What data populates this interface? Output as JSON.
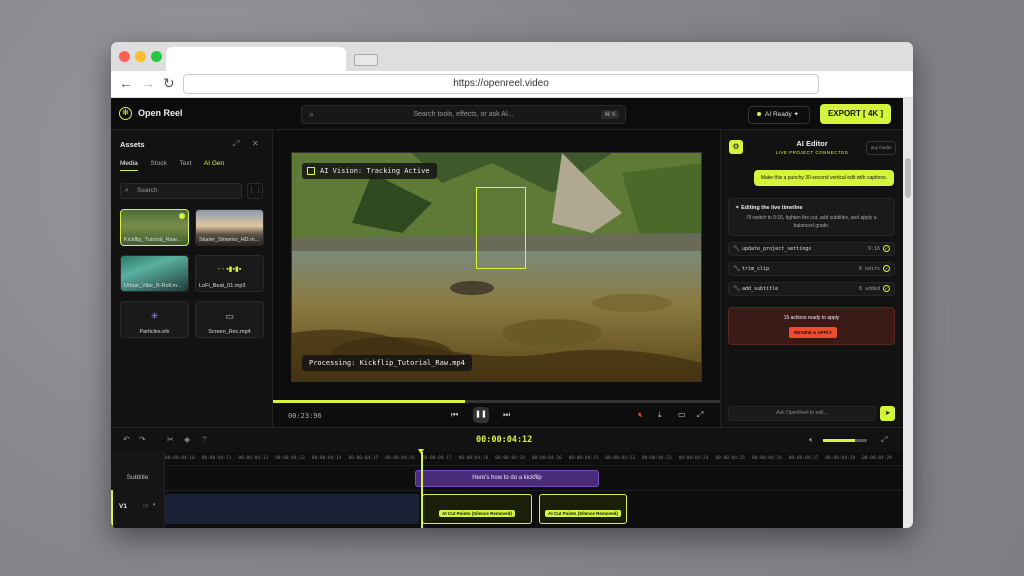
{
  "browser": {
    "url": "https://openreel.video"
  },
  "app": {
    "name": "Open Reel"
  },
  "search": {
    "placeholder": "Search tools, effects, or ask AI...",
    "shortcut": "⌘ K"
  },
  "status": {
    "ai_ready": "AI Ready"
  },
  "export": {
    "label": "EXPORT [ 4K ]"
  },
  "assets": {
    "title": "Assets",
    "tabs": [
      "Media",
      "Stock",
      "Text",
      "AI Gen"
    ],
    "search_placeholder": "Search",
    "items": [
      {
        "label": "Kickflip_Tutorial_Raw..."
      },
      {
        "label": "Skater_Slowmo_HD.m..."
      },
      {
        "label": "Urban_Vibe_B-Roll.m..."
      },
      {
        "label": "LoFi_Beat_01.mp3"
      },
      {
        "label": "Particles.efx"
      },
      {
        "label": "Screen_Rec.mp4"
      }
    ]
  },
  "preview": {
    "vision_badge": "AI Vision: Tracking Active",
    "processing": "Processing: Kickflip_Tutorial_Raw.mp4",
    "timecode": "00:23:96",
    "progress": 0.43
  },
  "editor": {
    "title": "AI Editor",
    "subtitle": "LIVE PROJECT CONNECTED",
    "model": "any model",
    "user_message": "Make this a punchy 30-second vertical edit with captions.",
    "ai_heading": "Editing the live timeline",
    "ai_text": "I'll switch to 9:16, tighten the cut, add subtitles, and apply a balanced grade.",
    "actions": [
      {
        "name": "update_project_settings",
        "value": "9:16"
      },
      {
        "name": "trim_clip",
        "value": "8 edits"
      },
      {
        "name": "add_subtitle",
        "value": "8 added"
      }
    ],
    "ready_text": "15 actions ready to apply",
    "review_label": "REVIEW & APPLY",
    "input_placeholder": "Ask OpenReel to edit..."
  },
  "timeline": {
    "timecode": "00:00:04:12",
    "volume": 0.72,
    "ruler": [
      "00:00:04:10",
      "00:00:04:11",
      "00:00:04:12",
      "00:00:04:13",
      "00:00:04:14",
      "00:00:04:15",
      "00:00:04:16",
      "00:00:04:17",
      "00:00:04:18",
      "00:00:04:19",
      "00:00:04:20",
      "00:00:04:21",
      "00:00:04:22",
      "00:00:04:23",
      "00:00:04:24",
      "00:00:04:25",
      "00:00:04:26",
      "00:00:04:27",
      "00:00:04:28",
      "00:00:04:29"
    ],
    "subtitle_track": "Subtitle",
    "subtitle_clip": "Here's how to do a kickflip",
    "video_track": "V1",
    "clip_label": "AI Cut Points (Silence Removed)"
  }
}
